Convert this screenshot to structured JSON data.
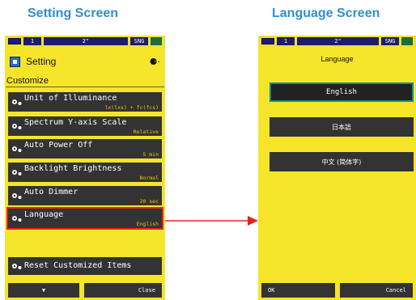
{
  "headings": {
    "left": "Setting Screen",
    "right": "Language Screen"
  },
  "status_bar": {
    "segments": [
      "1",
      "2\"",
      "SNG"
    ]
  },
  "setting_screen": {
    "title": "Setting",
    "menu_icon": "⚈·",
    "section": "Customize",
    "items": [
      {
        "label": "Unit of Illuminance",
        "value": "lx(lxs) + fc(fcs)",
        "icon": "gears-icon"
      },
      {
        "label": "Spectrum Y-axis Scale",
        "value": "Relative",
        "icon": "gears-icon"
      },
      {
        "label": "Auto Power Off",
        "value": "5 min",
        "icon": "gears-icon"
      },
      {
        "label": "Backlight Brightness",
        "value": "Normal",
        "icon": "gears-icon"
      },
      {
        "label": "Auto Dimmer",
        "value": "20 sec",
        "icon": "gears-icon"
      },
      {
        "label": "Language",
        "value": "English",
        "icon": "gears-icon",
        "selected": true
      }
    ],
    "reset_label": "Reset Customized Items",
    "down_label": "▼",
    "close_label": "Close"
  },
  "language_screen": {
    "title": "Language",
    "options": [
      "English",
      "日本語",
      "中文 (简体字)"
    ],
    "ok_label": "OK",
    "cancel_label": "Cancel"
  },
  "colors": {
    "screen": "#f5e52a",
    "button": "#333333",
    "value_text": "#f2c400",
    "highlight": "#e6231a",
    "heading": "#2f8fd1"
  }
}
